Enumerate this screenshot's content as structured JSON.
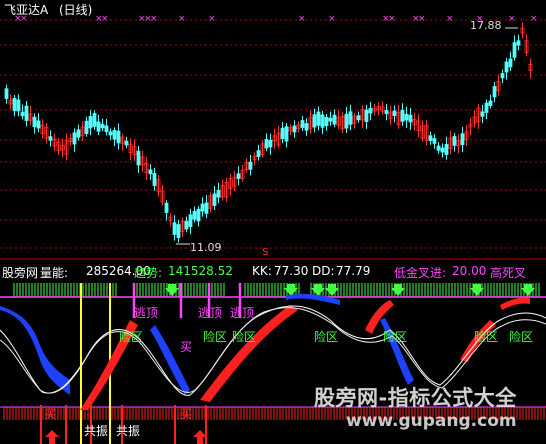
{
  "top_pane": {
    "title": "飞亚达A",
    "period": "(日线)",
    "high_label": "17.88",
    "low_label": "11.09",
    "marker": "S"
  },
  "indicator_bar": {
    "site": "股旁网",
    "volume_label": "量能:",
    "volume_value": "285264.00",
    "trend_label": "趋势:",
    "trend_value": "141528.52",
    "kk_label": "KK:",
    "kk_value": "77.30",
    "dd_label": "DD:",
    "dd_value": "77.79",
    "cross_label": "低金叉进:",
    "cross_value": "20.00",
    "dead_cross_label": "高死叉"
  },
  "annotations": {
    "top_escape": "逃顶",
    "danger_zone": "险区",
    "buy": "买",
    "resonance": "共振"
  },
  "watermark": {
    "text": "股旁网-指标公式大全",
    "url": "www.gupang.com"
  },
  "colors": {
    "up_candle": "#ff3232",
    "down_candle": "#54ffff",
    "grid": "#b00000",
    "magenta": "#ff44ff",
    "green": "#44ff44",
    "red_band": "#ff2020",
    "blue_band": "#2040ff",
    "yellow": "#ffff33"
  }
}
